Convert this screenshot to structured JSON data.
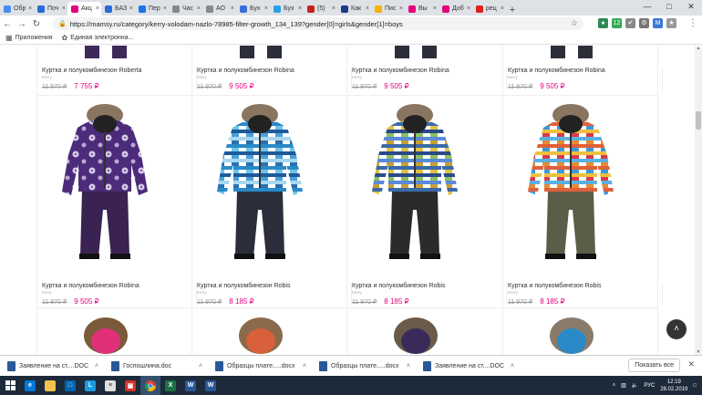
{
  "browser": {
    "tabs": [
      {
        "label": "Обр",
        "color": "#4a8af4"
      },
      {
        "label": "Поч",
        "color": "#2a6ad4"
      },
      {
        "label": "Акц",
        "color": "#e5007e",
        "active": true
      },
      {
        "label": "БАЗ",
        "color": "#2a6ad4"
      },
      {
        "label": "Пер",
        "color": "#1a73e8"
      },
      {
        "label": "Час",
        "color": "#888888"
      },
      {
        "label": "АО",
        "color": "#888888"
      },
      {
        "label": "Бух",
        "color": "#3b6fd8"
      },
      {
        "label": "Бух",
        "color": "#2aa0e0"
      },
      {
        "label": "(5)",
        "color": "#c5221f"
      },
      {
        "label": "Как",
        "color": "#1a3a8a"
      },
      {
        "label": "Пис",
        "color": "#f4b400"
      },
      {
        "label": "Вы",
        "color": "#e5007e"
      },
      {
        "label": "Доб",
        "color": "#e5007e"
      },
      {
        "label": "рец",
        "color": "#e02020"
      }
    ],
    "url": "https://mamsy.ru/category/kerry-xolodam-nazlo-78985-filter-growth_134_139?gender[0]=girls&gender[1]=boys",
    "bookmarks": [
      {
        "label": "Приложения",
        "icon": "apps-grid-icon"
      },
      {
        "label": "Единая электронна...",
        "icon": "emblem-icon"
      }
    ],
    "extensions": [
      {
        "label": "●",
        "color": "#2e8b57"
      },
      {
        "label": "12",
        "color": "#34a853"
      },
      {
        "label": "✔",
        "color": "#888888"
      },
      {
        "label": "⚙",
        "color": "#777777"
      },
      {
        "label": "M",
        "color": "#3a78d8"
      },
      {
        "label": "★",
        "color": "#999999"
      }
    ]
  },
  "products_top": [
    {
      "title": "Куртка и полукомбинезон Roberta",
      "brand": "Kerry",
      "old": "11 570 ₽",
      "new": "7 755 ₽"
    },
    {
      "title": "Куртка и полукомбинезон Robina",
      "brand": "Kerry",
      "old": "11 970 ₽",
      "new": "9 505 ₽"
    },
    {
      "title": "Куртка и полукомбинезон Robina",
      "brand": "Kerry",
      "old": "11 970 ₽",
      "new": "9 505 ₽"
    },
    {
      "title": "Куртка и полукомбинезон Robina",
      "brand": "Kerry",
      "old": "11 970 ₽",
      "new": "9 505 ₽"
    }
  ],
  "products_mid": [
    {
      "title": "Куртка и полукомбинезон Robina",
      "brand": "Kerry",
      "old": "11 970 ₽",
      "new": "9 505 ₽",
      "jacket": "#4b2b7a",
      "pants": "#3a2252",
      "pattern": "flower"
    },
    {
      "title": "Куртка и полукомбинезон Robis",
      "brand": "Kerry",
      "old": "11 970 ₽",
      "new": "8 185 ₽",
      "jacket": "#2a8ac8",
      "pants": "#2b2e3a",
      "pattern": "stripes-blue"
    },
    {
      "title": "Куртка и полукомбинезон Robis",
      "brand": "Kerry",
      "old": "11 970 ₽",
      "new": "8 185 ₽",
      "jacket": "#3b6aa8",
      "pants": "#2b2b2b",
      "pattern": "stripes-green"
    },
    {
      "title": "Куртка и полукомбинезон Robis",
      "brand": "Kerry",
      "old": "11 970 ₽",
      "new": "8 185 ₽",
      "jacket": "#e0603a",
      "pants": "#5a5e48",
      "pattern": "stripes-multi"
    }
  ],
  "downloads": [
    {
      "label": "Заявление на ст....DOC"
    },
    {
      "label": "Госпошлина.doc"
    },
    {
      "label": "Образцы плате.....docx"
    },
    {
      "label": "Образцы плате.....docx"
    },
    {
      "label": "Заявление на ст....DOC"
    }
  ],
  "show_all_label": "Показать все",
  "taskbar": {
    "lang": "РУС",
    "time": "12:19",
    "date": "28.02.2019"
  }
}
